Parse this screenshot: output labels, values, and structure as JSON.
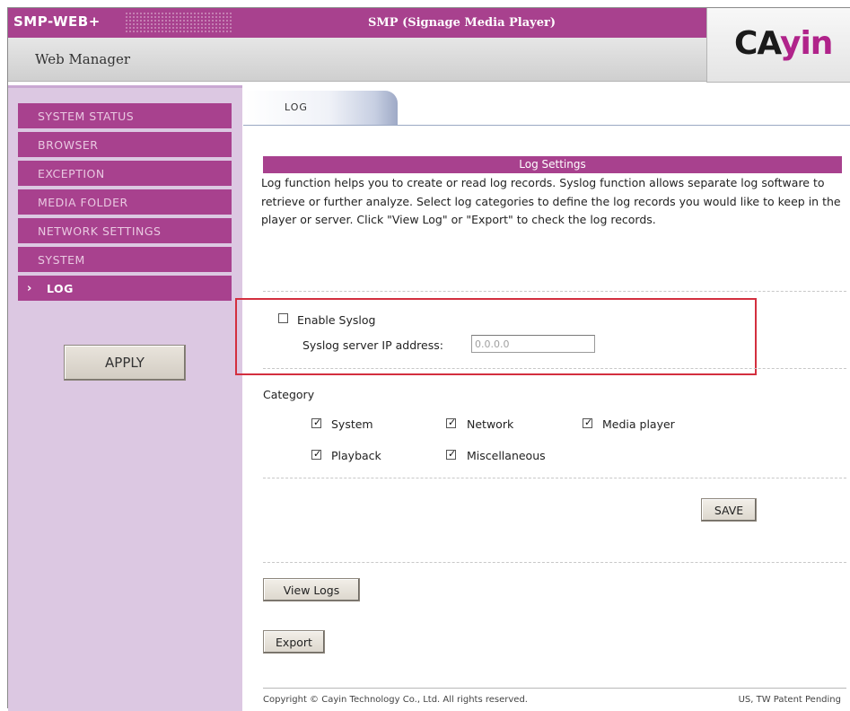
{
  "header": {
    "logo_text": "SMP-WEB+",
    "product_title": "SMP (Signage Media Player)",
    "subtitle": "Web Manager",
    "brand_logo": {
      "text_dark": "CA",
      "text_accent": "yin",
      "accent_color": "#b0238a"
    }
  },
  "sidebar": {
    "items": [
      {
        "label": "SYSTEM STATUS",
        "active": false
      },
      {
        "label": "BROWSER",
        "active": false
      },
      {
        "label": "EXCEPTION",
        "active": false
      },
      {
        "label": "MEDIA FOLDER",
        "active": false
      },
      {
        "label": "NETWORK SETTINGS",
        "active": false
      },
      {
        "label": "SYSTEM",
        "active": false
      },
      {
        "label": "LOG",
        "active": true
      }
    ],
    "apply_label": "APPLY"
  },
  "tabs": [
    {
      "label": "LOG",
      "active": true
    }
  ],
  "main": {
    "section_title": "Log Settings",
    "description": "Log function helps you to create or read log records. Syslog function allows separate log software to retrieve or further analyze. Select log categories to define the log records you would like to keep in the player or server. Click \"View Log\" or \"Export\" to check the log records.",
    "syslog": {
      "enable_label": "Enable Syslog",
      "enabled": false,
      "ip_label": "Syslog server IP address:",
      "ip_value": "0.0.0.0"
    },
    "category": {
      "heading": "Category",
      "items": [
        {
          "label": "System",
          "checked": true
        },
        {
          "label": "Network",
          "checked": true
        },
        {
          "label": "Media player",
          "checked": true
        },
        {
          "label": "Playback",
          "checked": true
        },
        {
          "label": "Miscellaneous",
          "checked": true
        }
      ]
    },
    "save_label": "SAVE",
    "view_logs_label": "View Logs",
    "export_label": "Export"
  },
  "footer": {
    "copyright": "Copyright © Cayin Technology Co., Ltd. All rights reserved.",
    "patent": "US, TW Patent Pending"
  },
  "colors": {
    "brand_purple": "#a8418e",
    "sidebar_bg": "#dcc8e2",
    "highlight_red": "#d32f3f"
  }
}
